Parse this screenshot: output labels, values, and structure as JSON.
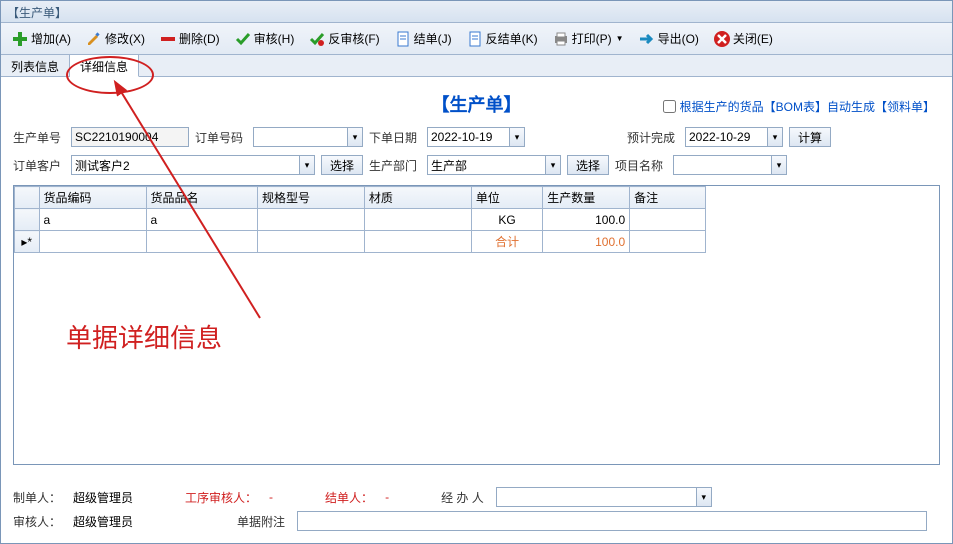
{
  "window": {
    "title": "【生产单】"
  },
  "toolbar": [
    {
      "name": "add",
      "label": "增加(A)",
      "icon": "plus",
      "color": "#2a9d2a"
    },
    {
      "name": "edit",
      "label": "修改(X)",
      "icon": "pencil",
      "color": "#d89020"
    },
    {
      "name": "delete",
      "label": "删除(D)",
      "icon": "minus",
      "color": "#d02020"
    },
    {
      "name": "audit",
      "label": "审核(H)",
      "icon": "check",
      "color": "#2a9d2a"
    },
    {
      "name": "unaudit",
      "label": "反审核(F)",
      "icon": "uncheck",
      "color": "#2a9d2a"
    },
    {
      "name": "close-bill",
      "label": "结单(J)",
      "icon": "doc",
      "color": "#3a7ad0"
    },
    {
      "name": "unclose-bill",
      "label": "反结单(K)",
      "icon": "doc",
      "color": "#3a7ad0"
    },
    {
      "name": "print",
      "label": "打印(P)",
      "icon": "printer",
      "color": "#888",
      "dropdown": true
    },
    {
      "name": "export",
      "label": "导出(O)",
      "icon": "arrow-right",
      "color": "#1a8ac0"
    },
    {
      "name": "close",
      "label": "关闭(E)",
      "icon": "x",
      "color": "#d02020"
    }
  ],
  "tabs": [
    {
      "name": "list",
      "label": "列表信息",
      "active": false
    },
    {
      "name": "detail",
      "label": "详细信息",
      "active": true
    }
  ],
  "doc": {
    "title": "【生产单】",
    "auto_gen_label": "根据生产的货品【BOM表】自动生成【领料单】",
    "fields": {
      "doc_no_label": "生产单号",
      "doc_no": "SC2210190004",
      "order_no_label": "订单号码",
      "order_no": "",
      "order_date_label": "下单日期",
      "order_date": "2022-10-19",
      "expect_done_label": "预计完成",
      "expect_done": "2022-10-29",
      "calc_label": "计算",
      "customer_label": "订单客户",
      "customer": "测试客户2",
      "select_label": "选择",
      "dept_label": "生产部门",
      "dept": "生产部",
      "project_label": "项目名称",
      "project": ""
    }
  },
  "grid": {
    "headers": [
      "货品编码",
      "货品品名",
      "规格型号",
      "材质",
      "单位",
      "生产数量",
      "备注"
    ],
    "rows": [
      {
        "code": "a",
        "name": "a",
        "spec": "",
        "material": "",
        "unit": "KG",
        "qty": "100.0",
        "remark": ""
      }
    ],
    "sum_label": "合计",
    "sum_qty": "100.0"
  },
  "footer": {
    "creator_label": "制单人：",
    "creator": "超级管理员",
    "proc_auditor_label": "工序审核人：",
    "proc_auditor": "-",
    "closer_label": "结单人：",
    "closer": "-",
    "handler_label": "经 办 人",
    "handler": "",
    "auditor_label": "审核人：",
    "auditor": "超级管理员",
    "attach_label": "单据附注",
    "attach": ""
  },
  "annotation": {
    "text": "单据详细信息"
  }
}
